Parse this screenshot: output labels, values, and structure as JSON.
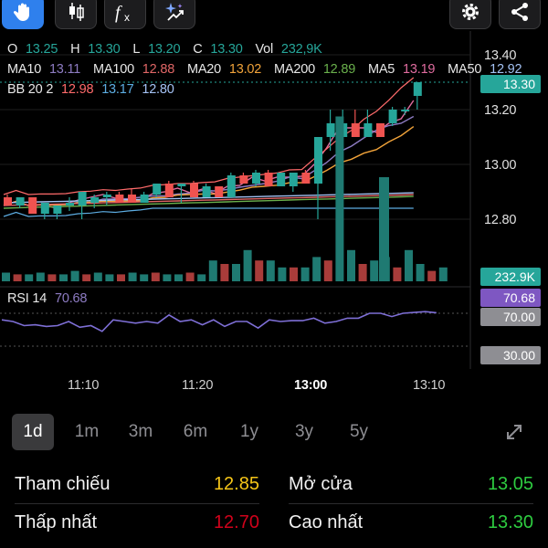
{
  "ohlc": {
    "o_label": "O",
    "o": "13.25",
    "h_label": "H",
    "h": "13.30",
    "l_label": "L",
    "l": "13.20",
    "c_label": "C",
    "c": "13.30",
    "vol_label": "Vol",
    "vol": "232,9K"
  },
  "ma": [
    {
      "label": "MA10",
      "value": "13.11",
      "color": "#8e7cc3"
    },
    {
      "label": "MA100",
      "value": "12.88",
      "color": "#e06666"
    },
    {
      "label": "MA20",
      "value": "13.02",
      "color": "#f1a33a"
    },
    {
      "label": "MA200",
      "value": "12.89",
      "color": "#6ab04c"
    },
    {
      "label": "MA5",
      "value": "13.19",
      "color": "#e06c9f"
    },
    {
      "label": "MA50",
      "value": "12.92",
      "color": "#a4c2f4"
    }
  ],
  "bb": {
    "label": "BB 20 2",
    "upper": "12.98",
    "mid": "13.17",
    "lower": "12.80",
    "upper_color": "#ff6b6b",
    "mid_color": "#5dade2",
    "lower_color": "#a4c2f4"
  },
  "price_axis": [
    "13.40",
    "13.20",
    "13.00",
    "12.80"
  ],
  "tags": {
    "last_price": "13.30",
    "volume": "232.9K",
    "rsi": "70.68",
    "rsi_upper": "70.00",
    "rsi_lower": "30.00"
  },
  "rsi": {
    "label": "RSI 14",
    "value": "70.68"
  },
  "time_axis": [
    "11:10",
    "11:20",
    "13:00",
    "13:10"
  ],
  "ranges": [
    "1d",
    "1m",
    "3m",
    "6m",
    "1y",
    "3y",
    "5y"
  ],
  "active_range": "1d",
  "stats": {
    "ref_label": "Tham chiếu",
    "ref_value": "12.85",
    "low_label": "Thấp nhất",
    "low_value": "12.70",
    "open_label": "Mở cửa",
    "open_value": "13.05",
    "high_label": "Cao nhất",
    "high_value": "13.30"
  },
  "colors": {
    "up": "#26a69a",
    "down": "#ef5350",
    "accent": "#5a9cf8",
    "yellow": "#f5c518",
    "red": "#d0021b",
    "green": "#2ecc40",
    "rsi_line": "#7e6fd6"
  },
  "chart_data": {
    "type": "candlestick",
    "candles": [
      {
        "o": 12.88,
        "h": 12.89,
        "l": 12.85,
        "c": 12.85
      },
      {
        "o": 12.85,
        "h": 12.88,
        "l": 12.84,
        "c": 12.88
      },
      {
        "o": 12.88,
        "h": 12.88,
        "l": 12.82,
        "c": 12.82
      },
      {
        "o": 12.82,
        "h": 12.86,
        "l": 12.8,
        "c": 12.86
      },
      {
        "o": 12.82,
        "h": 12.85,
        "l": 12.8,
        "c": 12.85
      },
      {
        "o": 12.85,
        "h": 12.88,
        "l": 12.83,
        "c": 12.86
      },
      {
        "o": 12.85,
        "h": 12.9,
        "l": 12.8,
        "c": 12.9
      },
      {
        "o": 12.86,
        "h": 12.89,
        "l": 12.84,
        "c": 12.88
      },
      {
        "o": 12.88,
        "h": 12.9,
        "l": 12.85,
        "c": 12.89
      },
      {
        "o": 12.89,
        "h": 12.9,
        "l": 12.86,
        "c": 12.86
      },
      {
        "o": 12.89,
        "h": 12.91,
        "l": 12.86,
        "c": 12.86
      },
      {
        "o": 12.86,
        "h": 12.9,
        "l": 12.86,
        "c": 12.89
      },
      {
        "o": 12.89,
        "h": 12.93,
        "l": 12.88,
        "c": 12.93
      },
      {
        "o": 12.93,
        "h": 12.94,
        "l": 12.88,
        "c": 12.88
      },
      {
        "o": 12.92,
        "h": 12.93,
        "l": 12.86,
        "c": 12.93
      },
      {
        "o": 12.93,
        "h": 12.94,
        "l": 12.88,
        "c": 12.88
      },
      {
        "o": 12.88,
        "h": 12.93,
        "l": 12.88,
        "c": 12.92
      },
      {
        "o": 12.92,
        "h": 12.92,
        "l": 12.88,
        "c": 12.88
      },
      {
        "o": 12.88,
        "h": 12.97,
        "l": 12.88,
        "c": 12.96
      },
      {
        "o": 12.96,
        "h": 12.97,
        "l": 12.93,
        "c": 12.93
      },
      {
        "o": 12.93,
        "h": 12.98,
        "l": 12.92,
        "c": 12.97
      },
      {
        "o": 12.97,
        "h": 12.98,
        "l": 12.92,
        "c": 12.92
      },
      {
        "o": 12.92,
        "h": 12.97,
        "l": 12.92,
        "c": 12.97
      },
      {
        "o": 12.92,
        "h": 12.97,
        "l": 12.9,
        "c": 12.97
      },
      {
        "o": 12.97,
        "h": 12.98,
        "l": 12.93,
        "c": 12.93
      },
      {
        "o": 12.93,
        "h": 13.1,
        "l": 12.8,
        "c": 13.1
      },
      {
        "o": 13.1,
        "h": 13.2,
        "l": 13.05,
        "c": 13.15
      },
      {
        "o": 13.1,
        "h": 13.2,
        "l": 13.05,
        "c": 13.15
      },
      {
        "o": 13.15,
        "h": 13.2,
        "l": 13.1,
        "c": 13.1
      },
      {
        "o": 13.1,
        "h": 13.2,
        "l": 13.1,
        "c": 13.15
      },
      {
        "o": 13.15,
        "h": 13.15,
        "l": 13.1,
        "c": 13.1
      },
      {
        "o": 13.15,
        "h": 13.21,
        "l": 13.14,
        "c": 13.2
      },
      {
        "o": 13.2,
        "h": 13.21,
        "l": 13.18,
        "c": 13.2
      },
      {
        "o": 13.25,
        "h": 13.3,
        "l": 13.2,
        "c": 13.3
      }
    ],
    "volume": [
      5,
      4,
      4,
      5,
      4,
      4,
      6,
      4,
      5,
      4,
      4,
      5,
      4,
      5,
      4,
      4,
      5,
      4,
      12,
      10,
      10,
      18,
      12,
      12,
      8,
      8,
      8,
      14,
      12,
      95,
      18,
      10,
      12,
      14,
      8,
      18,
      10,
      6,
      8
    ],
    "rsi": [
      62,
      60,
      55,
      56,
      54,
      55,
      60,
      53,
      55,
      48,
      62,
      60,
      58,
      60,
      58,
      68,
      60,
      62,
      56,
      62,
      54,
      60,
      60,
      52,
      62,
      60,
      61,
      61,
      64,
      58,
      60,
      64,
      64,
      70,
      70,
      66,
      70,
      71,
      72,
      70.68
    ],
    "rsi_levels": [
      70,
      30
    ],
    "ylim": [
      12.7,
      13.45
    ]
  }
}
